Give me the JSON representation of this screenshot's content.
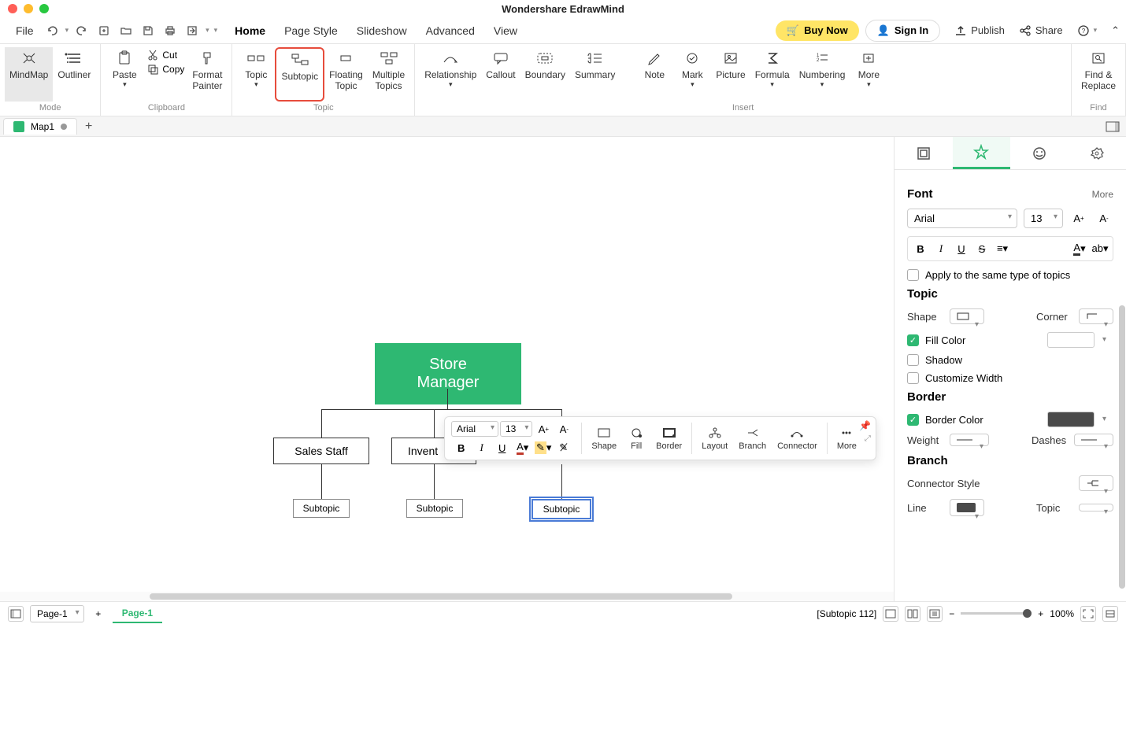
{
  "app": {
    "title": "Wondershare EdrawMind"
  },
  "menu": {
    "file": "File",
    "home": "Home",
    "page_style": "Page Style",
    "slideshow": "Slideshow",
    "advanced": "Advanced",
    "view": "View",
    "buy_now": "Buy Now",
    "sign_in": "Sign In",
    "publish": "Publish",
    "share": "Share"
  },
  "ribbon": {
    "mindmap": "MindMap",
    "outliner": "Outliner",
    "mode_label": "Mode",
    "paste": "Paste",
    "cut": "Cut",
    "copy": "Copy",
    "format_painter": "Format\nPainter",
    "clipboard_label": "Clipboard",
    "topic": "Topic",
    "subtopic": "Subtopic",
    "floating_topic": "Floating\nTopic",
    "multiple_topics": "Multiple\nTopics",
    "topic_label": "Topic",
    "relationship": "Relationship",
    "callout": "Callout",
    "boundary": "Boundary",
    "summary": "Summary",
    "note": "Note",
    "mark": "Mark",
    "picture": "Picture",
    "formula": "Formula",
    "numbering": "Numbering",
    "more": "More",
    "insert_label": "Insert",
    "find_replace": "Find &\nReplace",
    "find_label": "Find"
  },
  "tabs": {
    "map1": "Map1"
  },
  "mindmap": {
    "root": "Store Manager",
    "child1": "Sales Staff",
    "child2": "Invent",
    "sub1": "Subtopic",
    "sub2": "Subtopic",
    "sub3": "Subtopic"
  },
  "float_toolbar": {
    "font": "Arial",
    "size": "13",
    "shape": "Shape",
    "fill": "Fill",
    "border": "Border",
    "layout": "Layout",
    "branch": "Branch",
    "connector": "Connector",
    "more": "More"
  },
  "panel": {
    "font_title": "Font",
    "more": "More",
    "font_family": "Arial",
    "font_size": "13",
    "apply_same": "Apply to the same type of topics",
    "topic_title": "Topic",
    "shape": "Shape",
    "corner": "Corner",
    "fill_color": "Fill Color",
    "shadow": "Shadow",
    "customize_width": "Customize Width",
    "border_title": "Border",
    "border_color": "Border Color",
    "weight": "Weight",
    "dashes": "Dashes",
    "branch_title": "Branch",
    "connector_style": "Connector Style",
    "line": "Line",
    "topic_lbl": "Topic"
  },
  "status": {
    "page_sel": "Page-1",
    "page_tab": "Page-1",
    "selection": "[Subtopic 112]",
    "zoom": "100%"
  }
}
